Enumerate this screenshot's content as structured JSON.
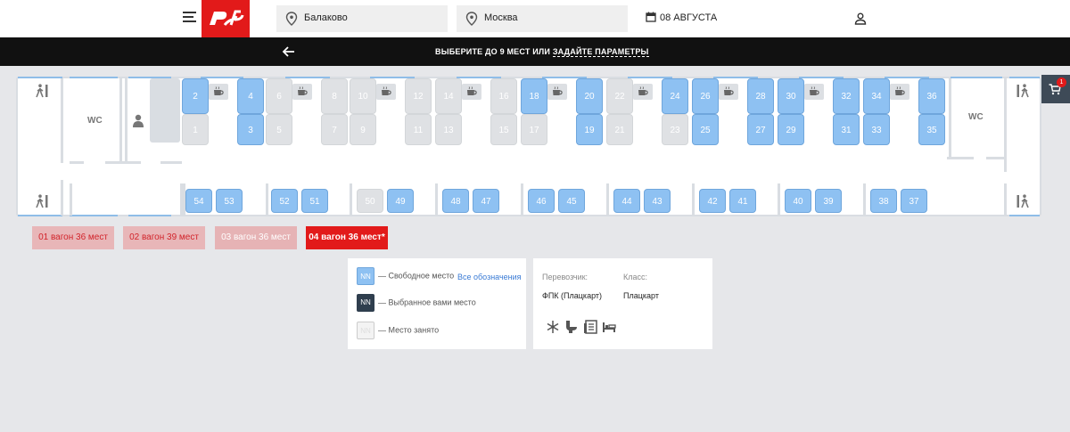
{
  "header": {
    "from": "Балаково",
    "to": "Москва",
    "date": "08 АВГУСТА"
  },
  "banner": {
    "text_start": "ВЫБЕРИТЕ ДО 9 МЕСТ ИЛИ ",
    "link": "ЗАДАЙТЕ ПАРАМЕТРЫ"
  },
  "cart": {
    "count": "1"
  },
  "car": {
    "wc_left": "WC",
    "wc_right": "WC"
  },
  "wagons": [
    {
      "label": "01 вагон 36 мест"
    },
    {
      "label": "02 вагон 39 мест"
    },
    {
      "label": "03 вагон 36 мест"
    },
    {
      "label": "04 вагон 36 мест*"
    }
  ],
  "legend": {
    "free_code": "NN",
    "free_label": "— Свободное место",
    "selected_code": "NN",
    "selected_label": "— Выбранное вами место",
    "taken_code": "NN",
    "taken_label": "— Место занято",
    "all_link": "Все обозначения"
  },
  "info": {
    "carrier_label": "Перевозчик:",
    "carrier_value": "ФПК (Плацкарт)",
    "class_label": "Класс:",
    "class_value": "Плацкарт"
  },
  "colors": {
    "brand": "#e21a1a",
    "free": "#8ec1f2",
    "selected": "#2f3e4e",
    "taken": "#dfe1e4"
  },
  "icons": {
    "amenities": [
      "snowflake-icon",
      "toilet-icon",
      "press-icon",
      "bed-icon"
    ]
  }
}
